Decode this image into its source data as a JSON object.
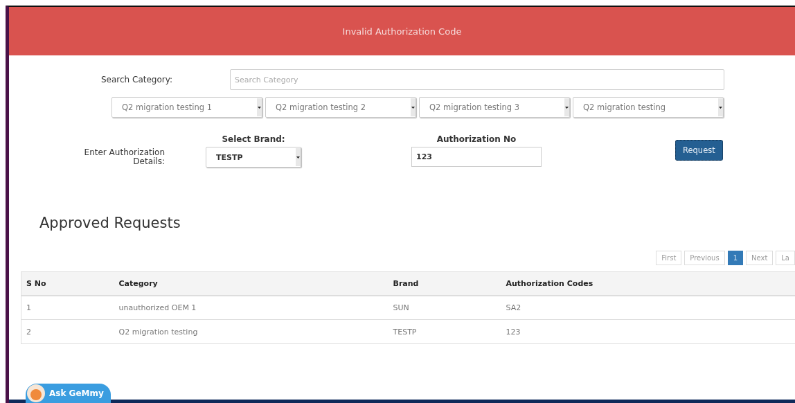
{
  "banner": {
    "title": "Invalid Authorization Code"
  },
  "search": {
    "label": "Search Category:",
    "placeholder": "Search Category"
  },
  "category_selects": [
    "Q2 migration testing 1",
    "Q2 migration testing 2",
    "Q2 migration testing 3",
    "Q2 migration testing"
  ],
  "authorization": {
    "label": "Enter Authorization Details:",
    "brand_label": "Select Brand:",
    "brand_value": "TESTP",
    "number_label": "Authorization No",
    "number_value": "123",
    "button": "Request"
  },
  "section_title": "Approved Requests",
  "pagination": [
    {
      "label": "First",
      "selected": false
    },
    {
      "label": "Previous",
      "selected": false
    },
    {
      "label": "1",
      "selected": true
    },
    {
      "label": "Next",
      "selected": false
    },
    {
      "label": "La",
      "selected": false
    }
  ],
  "table": {
    "columns": [
      "S No",
      "Category",
      "Brand",
      "Authorization Codes"
    ],
    "rows": [
      [
        "1",
        "unauthorized OEM 1",
        "SUN",
        "SA2"
      ],
      [
        "2",
        "Q2 migration testing",
        "TESTP",
        "123"
      ]
    ]
  },
  "chat_button": {
    "label": "Ask GeMmy"
  }
}
